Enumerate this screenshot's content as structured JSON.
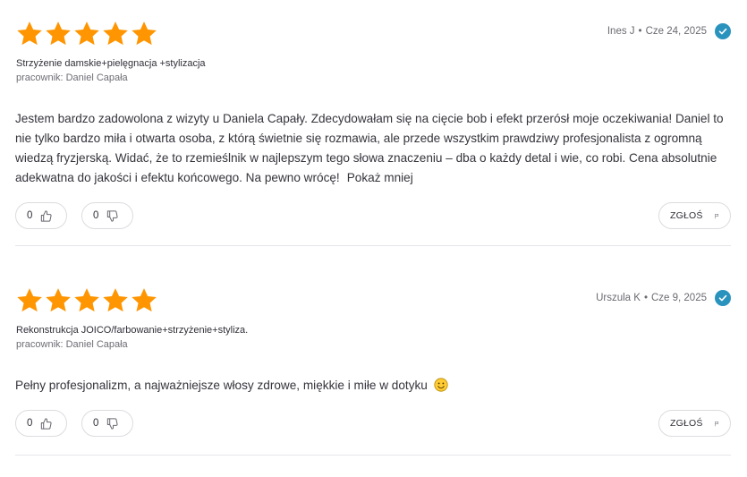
{
  "reviews": [
    {
      "rating": 5,
      "author": "Ines J",
      "date": "Cze 24, 2025",
      "service": "Strzyżenie damskie+pielęgnacja +stylizacja",
      "employee_label": "pracownik:",
      "employee_name": "Daniel Capała",
      "text": "Jestem bardzo zadowolona z wizyty u Daniela Capały. Zdecydowałam się na cięcie bob i efekt przerósł moje oczekiwania! Daniel to nie tylko bardzo miła i otwarta osoba, z którą świetnie się rozmawia, ale przede wszystkim prawdziwy profesjonalista z ogromną wiedzą fryzjerską. Widać, że to rzemieślnik w najlepszym tego słowa znaczeniu – dba o każdy detal i wie, co robi. Cena absolutnie adekwatna do jakości i efektu końcowego. Na pewno wrócę!",
      "show_less": "Pokaż mniej",
      "likes": "0",
      "dislikes": "0",
      "report_label": "ZGŁOŚ"
    },
    {
      "rating": 5,
      "author": "Urszula K",
      "date": "Cze 9, 2025",
      "service": "Rekonstrukcja JOICO/farbowanie+strzyżenie+styliza.",
      "employee_label": "pracownik:",
      "employee_name": "Daniel Capała",
      "text": "Pełny profesjonalizm, a najważniejsze włosy zdrowe, miękkie i miłe w dotyku",
      "emoji": "slightly-smiling-face-icon",
      "likes": "0",
      "dislikes": "0",
      "report_label": "ZGŁOŚ"
    }
  ],
  "colors": {
    "star": "#FF9500",
    "verified": "#2A93BD",
    "border": "#DCDCE0",
    "divider": "#E6E6EA"
  }
}
